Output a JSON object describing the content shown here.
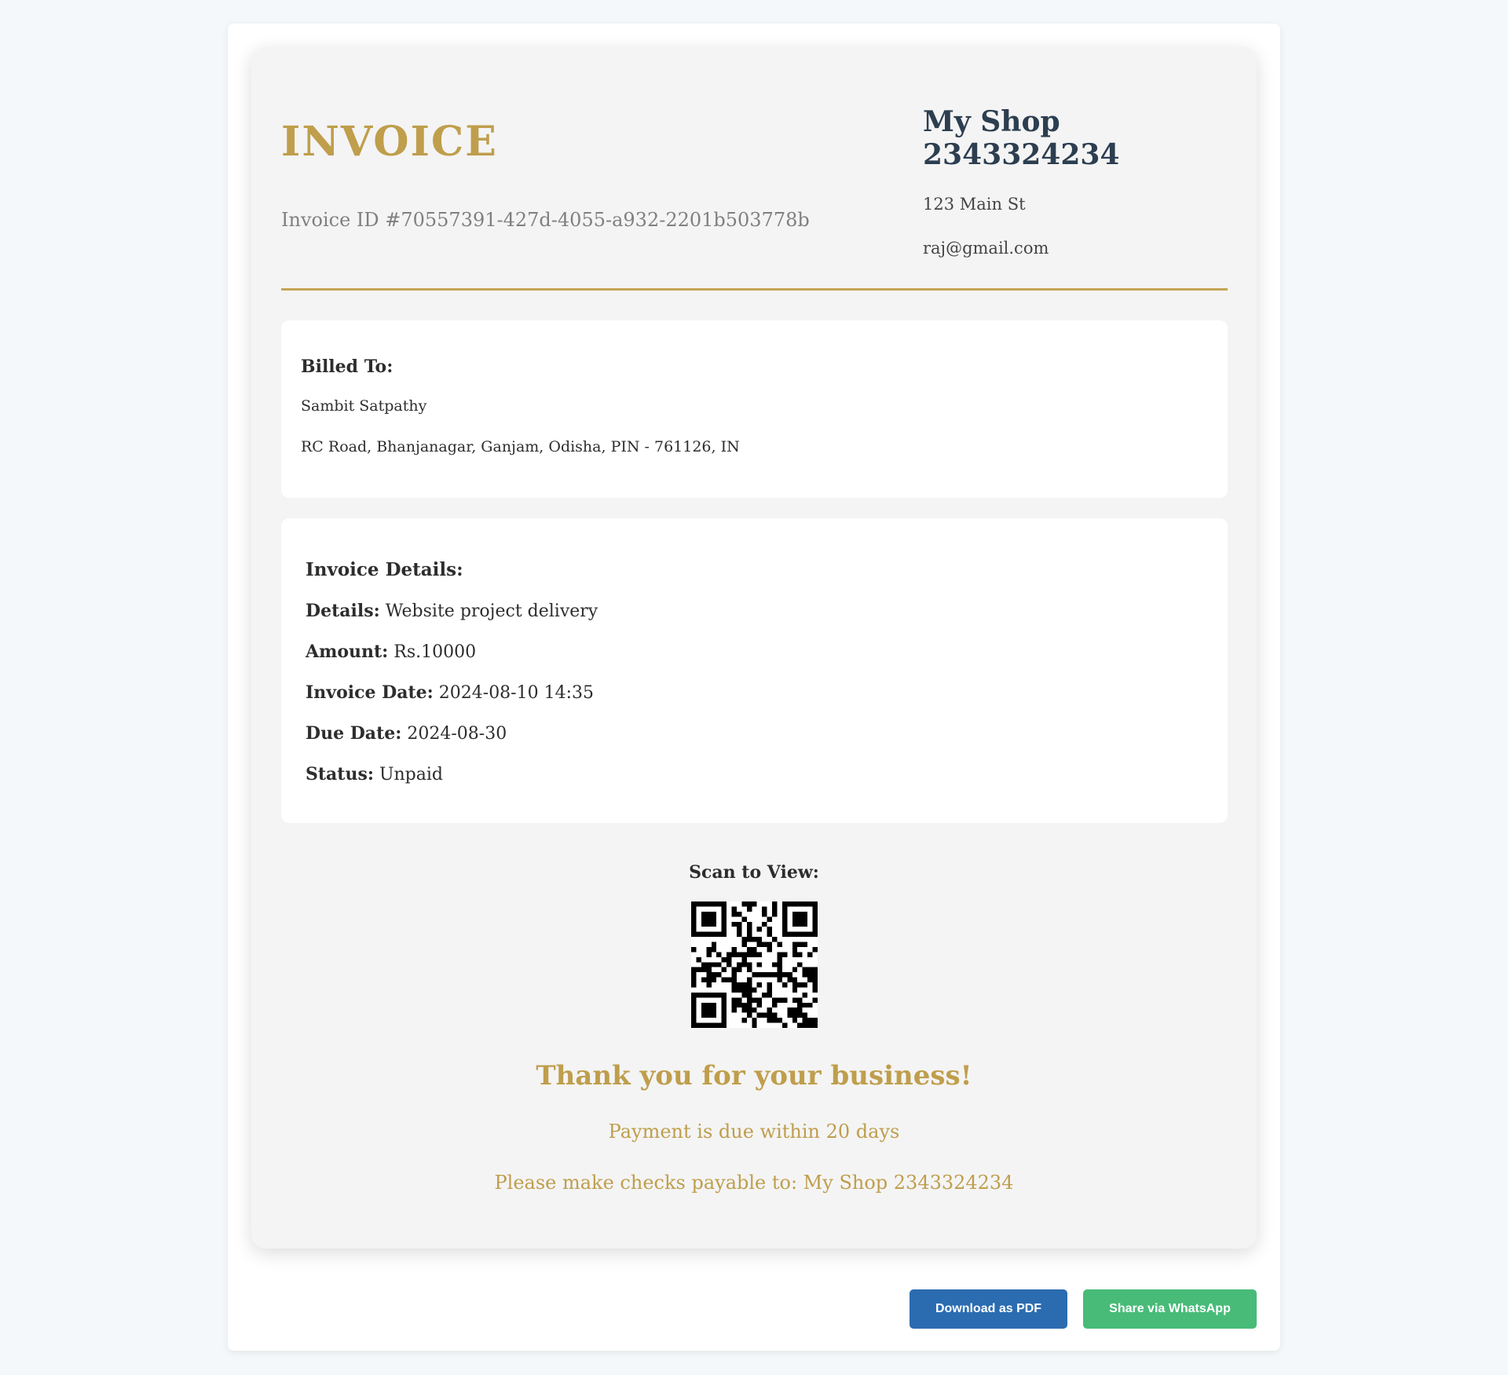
{
  "header": {
    "title": "INVOICE",
    "invoice_id": "Invoice ID #70557391-427d-4055-a932-2201b503778b"
  },
  "shop": {
    "name": "My Shop 2343324234",
    "address": "123 Main St",
    "email": "raj@gmail.com"
  },
  "billed_to": {
    "heading": "Billed To:",
    "name": "Sambit Satpathy",
    "address": "RC Road, Bhanjanagar, Ganjam, Odisha, PIN - 761126, IN"
  },
  "invoice_details": {
    "heading": "Invoice Details:",
    "rows": [
      {
        "label": "Details:",
        "value": "Website project delivery"
      },
      {
        "label": "Amount:",
        "value": "Rs.10000"
      },
      {
        "label": "Invoice Date:",
        "value": "2024-08-10 14:35"
      },
      {
        "label": "Due Date:",
        "value": "2024-08-30"
      },
      {
        "label": "Status:",
        "value": "Unpaid"
      }
    ]
  },
  "qr": {
    "heading": "Scan to View:",
    "icon": "qr-code-icon"
  },
  "footer": {
    "thank_you": "Thank you for your business!",
    "payment_terms": "Payment is due within 20 days",
    "payable_to": "Please make checks payable to: My Shop 2343324234"
  },
  "actions": {
    "download_pdf": "Download as PDF",
    "share_whatsapp": "Share via WhatsApp"
  },
  "colors": {
    "accent_gold": "#bf9e4c",
    "shop_name": "#2c3e50",
    "pdf_button": "#2b6cb0",
    "whatsapp_button": "#48bb78"
  }
}
